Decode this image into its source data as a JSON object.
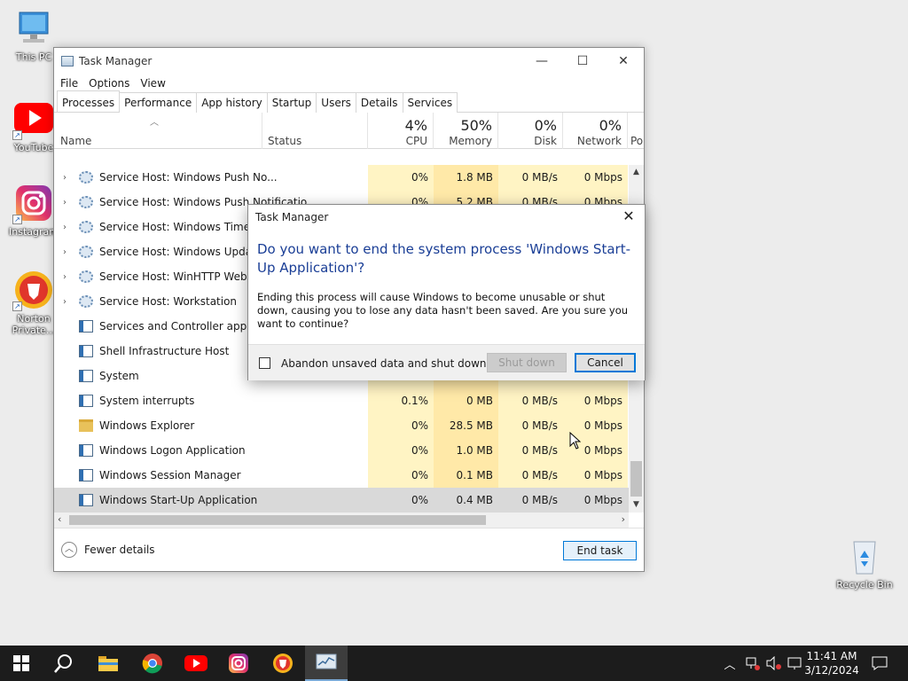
{
  "desktop": {
    "icons": [
      {
        "label": "This PC"
      },
      {
        "label": "YouTube"
      },
      {
        "label": "Instagram"
      },
      {
        "label": "Norton Private..."
      },
      {
        "label": "Recycle Bin"
      }
    ]
  },
  "window": {
    "title": "Task Manager",
    "menu": [
      "File",
      "Options",
      "View"
    ],
    "tabs": [
      "Processes",
      "Performance",
      "App history",
      "Startup",
      "Users",
      "Details",
      "Services"
    ],
    "active_tab": "Processes",
    "columns": {
      "name": "Name",
      "status": "Status",
      "cpu": {
        "pct": "4%",
        "label": "CPU"
      },
      "memory": {
        "pct": "50%",
        "label": "Memory"
      },
      "disk": {
        "pct": "0%",
        "label": "Disk"
      },
      "network": {
        "pct": "0%",
        "label": "Network"
      },
      "power": {
        "label": "Po"
      }
    },
    "processes": [
      {
        "name": "Service Host: Windows Push No...",
        "icon": "gear-icon",
        "expandable": true,
        "cpu": "0%",
        "mem": "1.8 MB",
        "disk": "0 MB/s",
        "net": "0 Mbps"
      },
      {
        "name": "Service Host: Windows Push Notifications",
        "icon": "gear-icon",
        "expandable": true,
        "cpu": "0%",
        "mem": "5.2 MB",
        "disk": "0 MB/s",
        "net": "0 Mbps"
      },
      {
        "name": "Service Host: Windows Time",
        "icon": "gear-icon",
        "expandable": true,
        "cpu": "",
        "mem": "",
        "disk": "",
        "net": ""
      },
      {
        "name": "Service Host: Windows Update",
        "icon": "gear-icon",
        "expandable": true,
        "cpu": "",
        "mem": "",
        "disk": "",
        "net": ""
      },
      {
        "name": "Service Host: WinHTTP Web Proxy",
        "icon": "gear-icon",
        "expandable": true,
        "cpu": "",
        "mem": "",
        "disk": "",
        "net": ""
      },
      {
        "name": "Service Host: Workstation",
        "icon": "gear-icon",
        "expandable": true,
        "cpu": "",
        "mem": "",
        "disk": "",
        "net": ""
      },
      {
        "name": "Services and Controller app",
        "icon": "window-icon",
        "expandable": false,
        "cpu": "",
        "mem": "",
        "disk": "",
        "net": ""
      },
      {
        "name": "Shell Infrastructure Host",
        "icon": "window-icon",
        "expandable": false,
        "cpu": "",
        "mem": "",
        "disk": "",
        "net": ""
      },
      {
        "name": "System",
        "icon": "window-icon",
        "expandable": false,
        "cpu": "",
        "mem": "",
        "disk": "",
        "net": ""
      },
      {
        "name": "System interrupts",
        "icon": "window-icon",
        "expandable": false,
        "cpu": "0.1%",
        "mem": "0 MB",
        "disk": "0 MB/s",
        "net": "0 Mbps"
      },
      {
        "name": "Windows Explorer",
        "icon": "folder-icon",
        "expandable": false,
        "cpu": "0%",
        "mem": "28.5 MB",
        "disk": "0 MB/s",
        "net": "0 Mbps"
      },
      {
        "name": "Windows Logon Application",
        "icon": "window-icon",
        "expandable": false,
        "cpu": "0%",
        "mem": "1.0 MB",
        "disk": "0 MB/s",
        "net": "0 Mbps"
      },
      {
        "name": "Windows Session Manager",
        "icon": "window-icon",
        "expandable": false,
        "cpu": "0%",
        "mem": "0.1 MB",
        "disk": "0 MB/s",
        "net": "0 Mbps"
      },
      {
        "name": "Windows Start-Up Application",
        "icon": "window-icon",
        "expandable": false,
        "cpu": "0%",
        "mem": "0.4 MB",
        "disk": "0 MB/s",
        "net": "0 Mbps",
        "selected": true
      }
    ],
    "fewer_details": "Fewer details",
    "end_task": "End task"
  },
  "dialog": {
    "title": "Task Manager",
    "heading": "Do you want to end the system process 'Windows Start-Up Application'?",
    "body": "Ending this process will cause Windows to become unusable or shut down, causing you to lose any data hasn't been saved. Are you sure you want to continue?",
    "checkbox_label": "Abandon unsaved data and shut down.",
    "checkbox_checked": false,
    "shutdown_label": "Shut down",
    "cancel_label": "Cancel"
  },
  "taskbar": {
    "clock_time": "11:41 AM",
    "clock_date": "3/12/2024"
  }
}
